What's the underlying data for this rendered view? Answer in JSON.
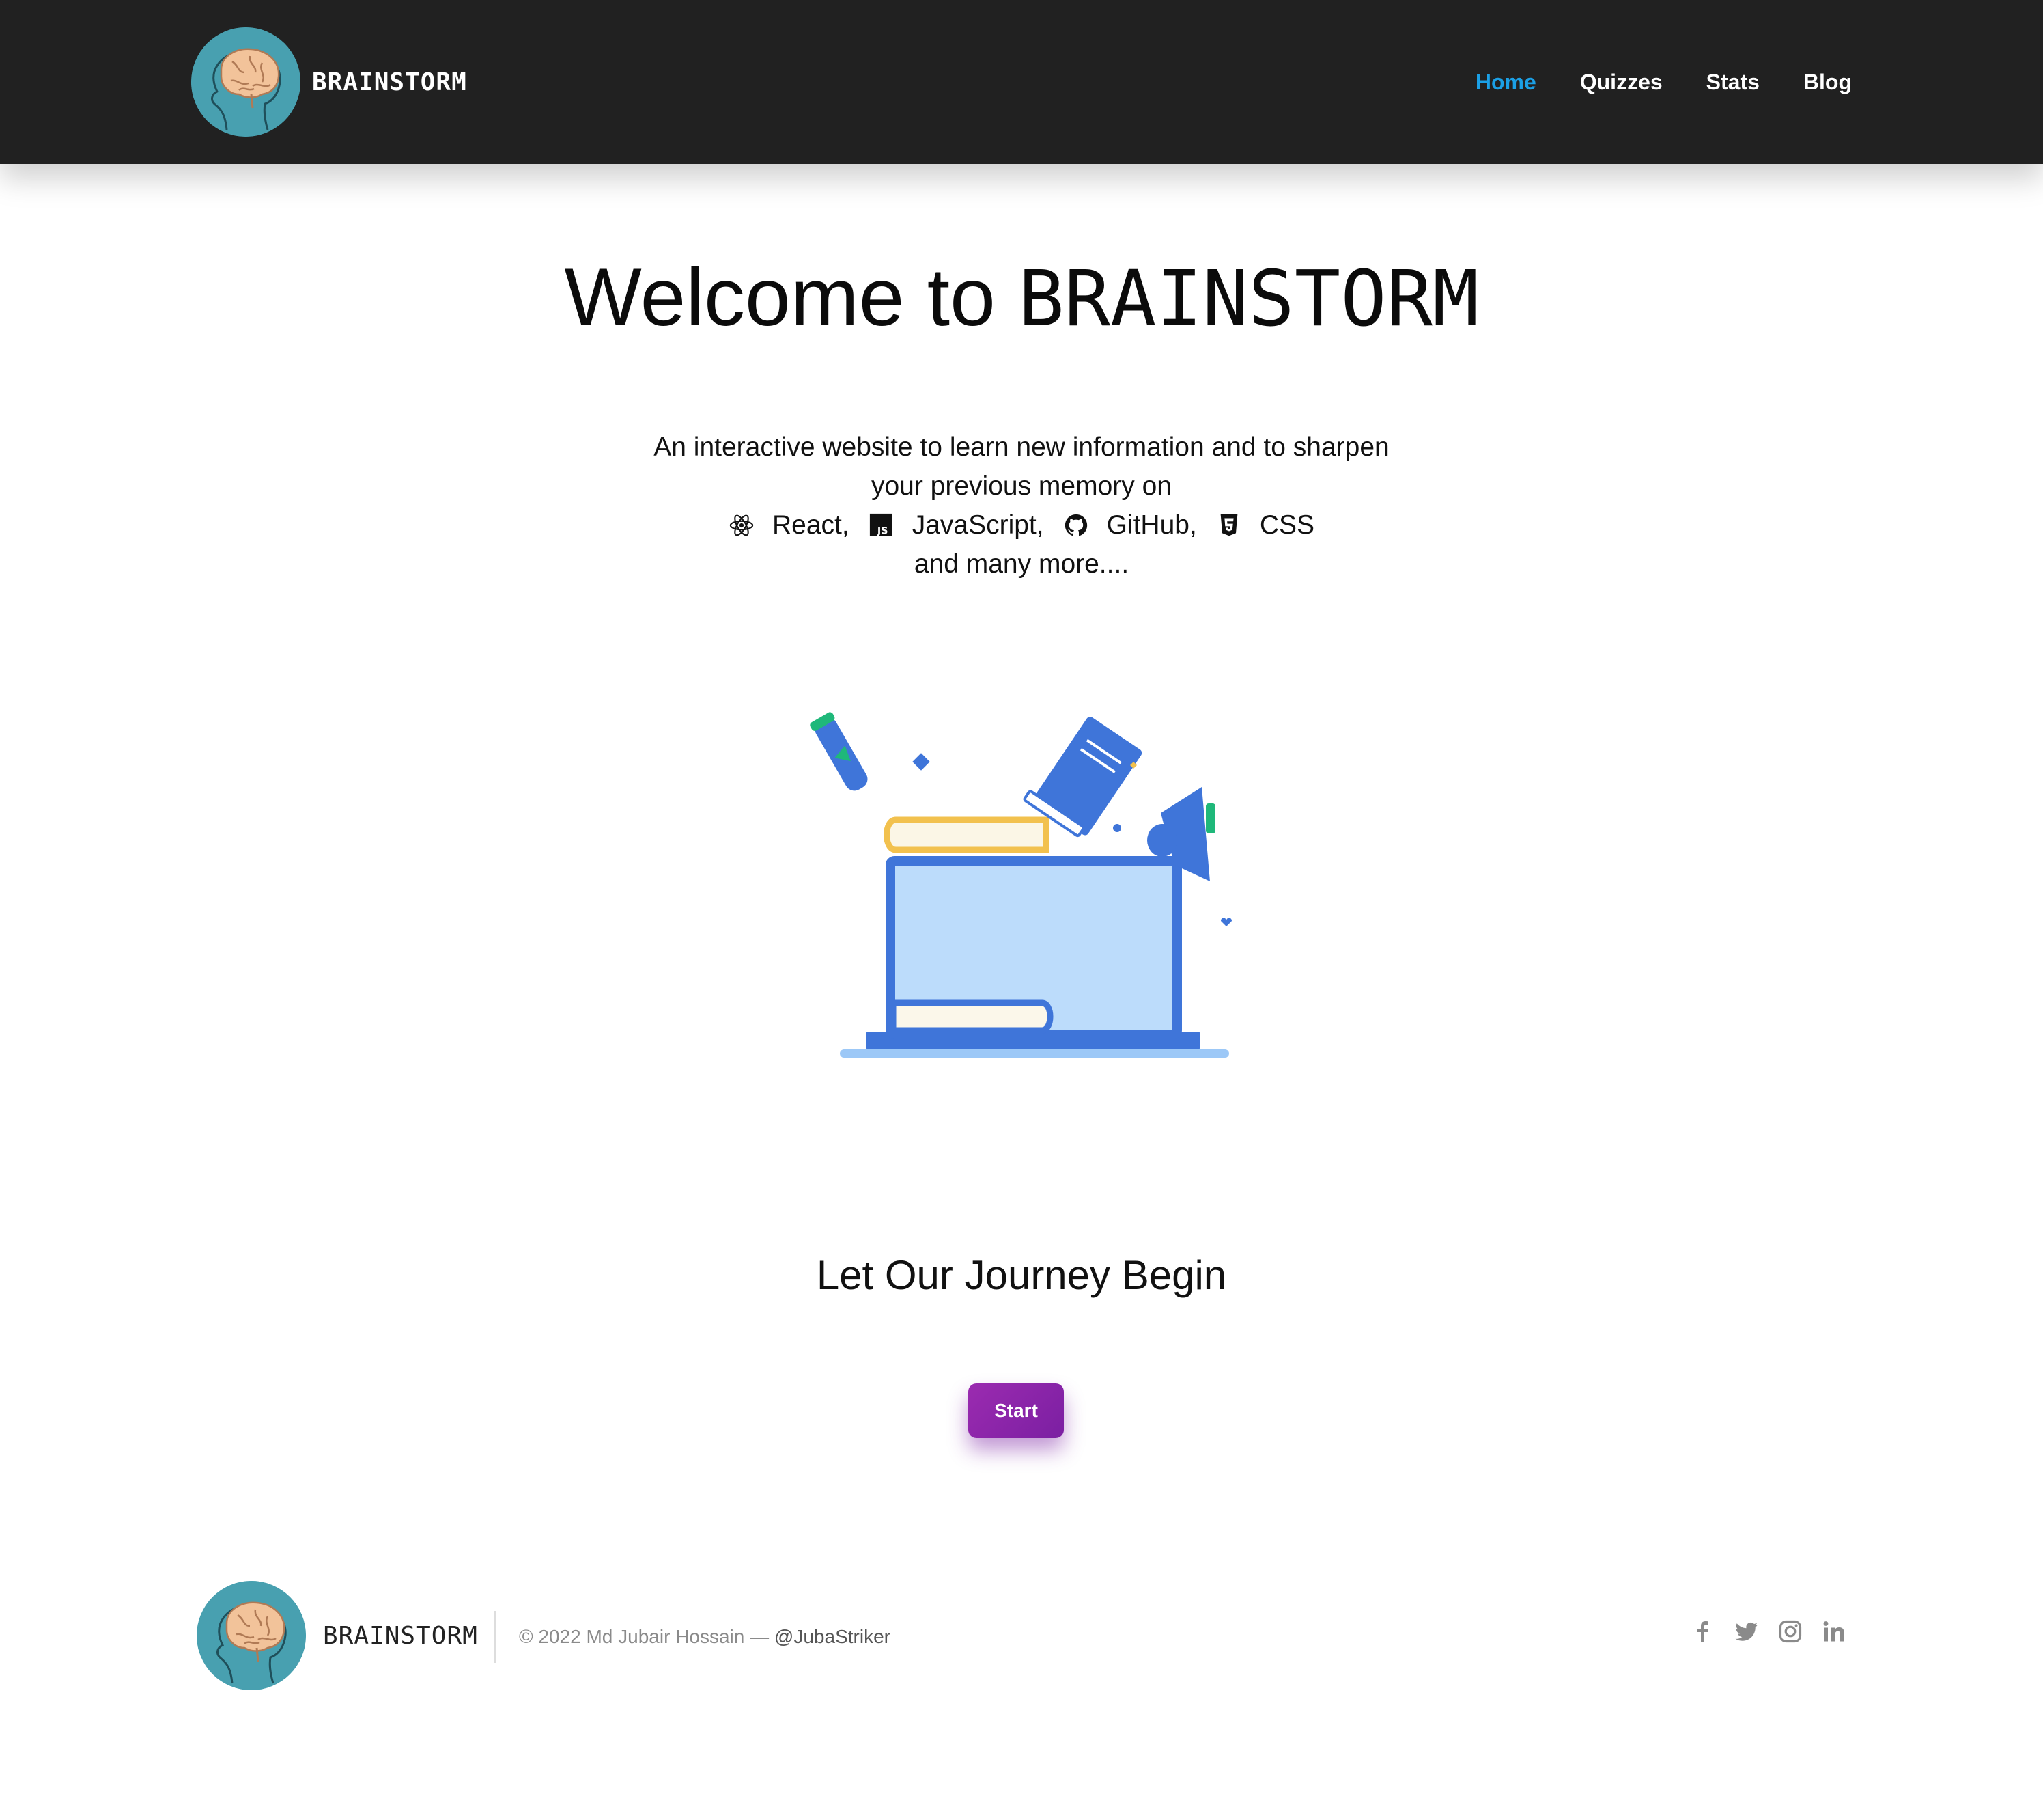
{
  "header": {
    "brand": "BRAINSTORM",
    "nav": [
      {
        "label": "Home",
        "active": true
      },
      {
        "label": "Quizzes",
        "active": false
      },
      {
        "label": "Stats",
        "active": false
      },
      {
        "label": "Blog",
        "active": false
      }
    ]
  },
  "hero": {
    "title_prefix": "Welcome to ",
    "title_brand": "BRAINSTORM",
    "intro_line1": "An interactive website to learn new information and to sharpen",
    "intro_line2": "your previous memory on",
    "tech": [
      {
        "icon": "react-icon",
        "label": "React,"
      },
      {
        "icon": "javascript-icon",
        "label": "JavaScript,"
      },
      {
        "icon": "github-icon",
        "label": "GitHub,"
      },
      {
        "icon": "css-icon",
        "label": "CSS"
      }
    ],
    "intro_line4": "and many more...."
  },
  "cta": {
    "heading": "Let Our Journey Begin",
    "button": "Start"
  },
  "footer": {
    "brand": "BRAINSTORM",
    "copyright": "© 2022 Md Jubair Hossain — ",
    "handle": "@JubaStriker",
    "socials": [
      "facebook-icon",
      "twitter-icon",
      "instagram-icon",
      "linkedin-icon"
    ]
  },
  "colors": {
    "navbar_bg": "#212121",
    "nav_active": "#1ba0e6",
    "logo_bg": "#48a0b0",
    "button_bg": "#8e24aa",
    "illustration_blue": "#3f75d9",
    "illustration_light": "#bcdcfb"
  }
}
